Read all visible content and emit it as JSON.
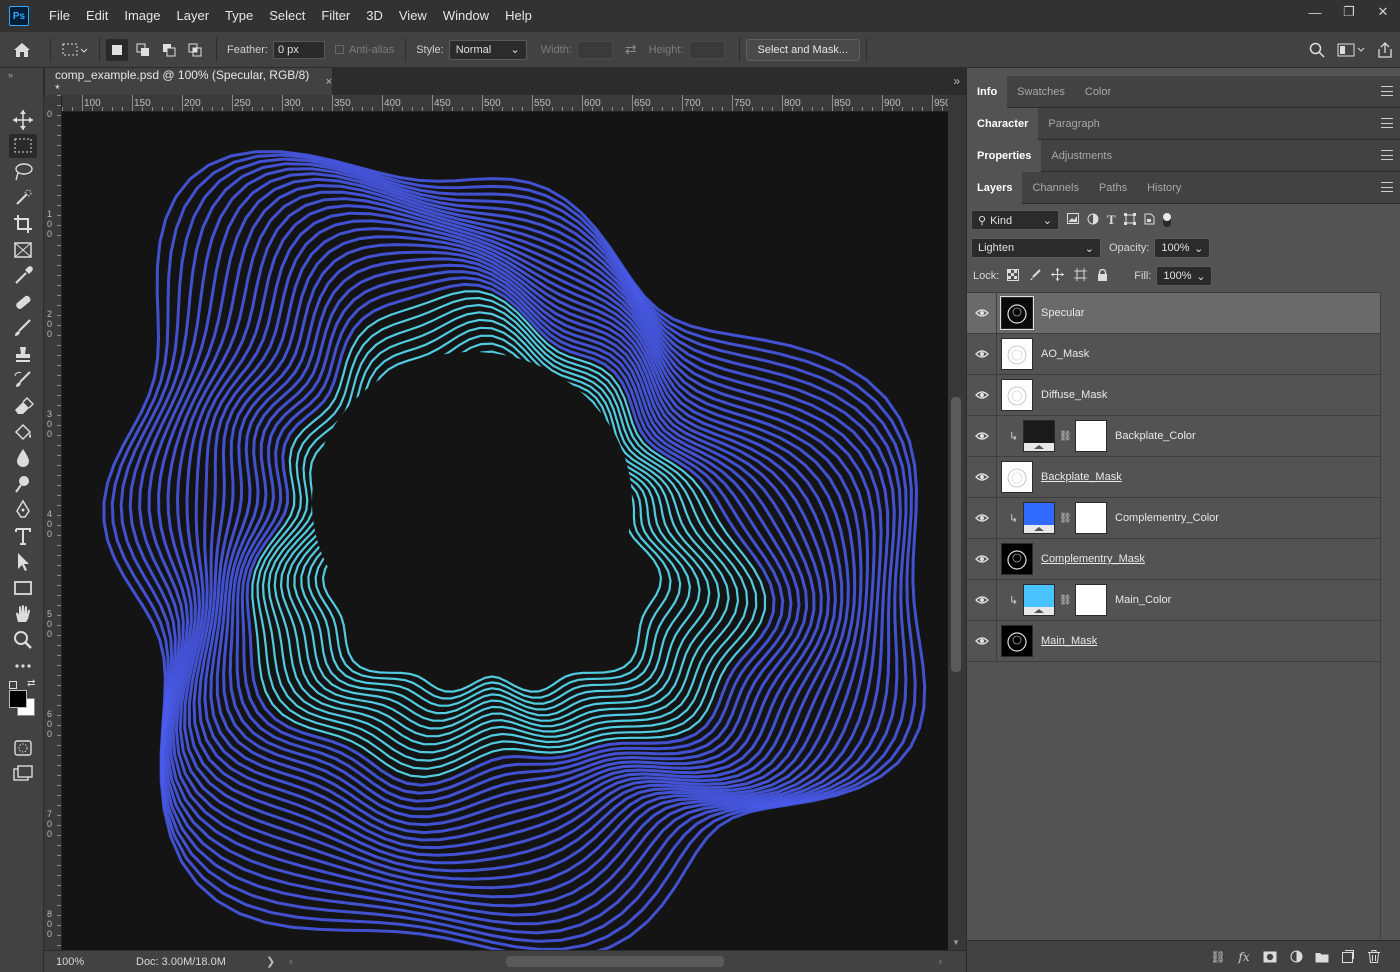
{
  "app": {
    "logo": "Ps"
  },
  "menu": [
    "File",
    "Edit",
    "Image",
    "Layer",
    "Type",
    "Select",
    "Filter",
    "3D",
    "View",
    "Window",
    "Help"
  ],
  "window_controls": {
    "minimize": "—",
    "restore": "❐",
    "close": "✕"
  },
  "options": {
    "feather_label": "Feather:",
    "feather_value": "0 px",
    "antialias_label": "Anti-alias",
    "style_label": "Style:",
    "style_value": "Normal",
    "width_label": "Width:",
    "height_label": "Height:",
    "select_mask_label": "Select and Mask..."
  },
  "document": {
    "tab_title": "comp_example.psd @ 100% (Specular, RGB/8) *",
    "tab_close": "×",
    "ruler_h": [
      "100",
      "150",
      "200",
      "250",
      "300",
      "350",
      "400",
      "450",
      "500",
      "550",
      "600",
      "650",
      "700",
      "750",
      "800",
      "850",
      "900",
      "950"
    ],
    "ruler_v": [
      "0",
      "1 0 0",
      "2 0 0",
      "3 0 0",
      "4 0 0",
      "5 0 0",
      "6 0 0",
      "7 0 0",
      "8 0 0",
      "9"
    ],
    "zoom": "100%",
    "doc_size": "Doc: 3.00M/18.0M",
    "status_arrow": "❯"
  },
  "panels": {
    "group1": [
      "Info",
      "Swatches",
      "Color"
    ],
    "group2": [
      "Character",
      "Paragraph"
    ],
    "group3": [
      "Properties",
      "Adjustments"
    ],
    "group4": [
      "Layers",
      "Channels",
      "Paths",
      "History"
    ]
  },
  "layers_controls": {
    "filter_kind": "Kind",
    "blend_mode": "Lighten",
    "opacity_label": "Opacity:",
    "opacity_value": "100%",
    "lock_label": "Lock:",
    "fill_label": "Fill:",
    "fill_value": "100%"
  },
  "layers": [
    {
      "name": "Specular",
      "selected": true,
      "thumb": "#0a0a0a",
      "clipped": false,
      "mask": false,
      "underline": false
    },
    {
      "name": "AO_Mask",
      "selected": false,
      "thumb": "#ffffff",
      "clipped": false,
      "mask": false,
      "underline": false
    },
    {
      "name": "Diffuse_Mask",
      "selected": false,
      "thumb": "#ffffff",
      "clipped": false,
      "mask": false,
      "underline": false
    },
    {
      "name": "Backplate_Color",
      "selected": false,
      "thumb": "#1a1a1a",
      "clipped": true,
      "mask": true,
      "underline": false
    },
    {
      "name": "Backplate_Mask",
      "selected": false,
      "thumb": "#ffffff",
      "clipped": false,
      "mask": false,
      "underline": true
    },
    {
      "name": "Complementry_Color",
      "selected": false,
      "thumb": "#2f6bff",
      "clipped": true,
      "mask": true,
      "underline": false
    },
    {
      "name": "Complementry_Mask",
      "selected": false,
      "thumb": "#000000",
      "clipped": false,
      "mask": false,
      "underline": true
    },
    {
      "name": "Main_Color",
      "selected": false,
      "thumb": "#49c3ff",
      "clipped": true,
      "mask": true,
      "underline": false
    },
    {
      "name": "Main_Mask",
      "selected": false,
      "thumb": "#000000",
      "clipped": false,
      "mask": false,
      "underline": true
    }
  ],
  "colors": {
    "artwork_outer": "#4a5cf0",
    "artwork_inner": "#55d4ea",
    "canvas_bg": "#141414"
  }
}
